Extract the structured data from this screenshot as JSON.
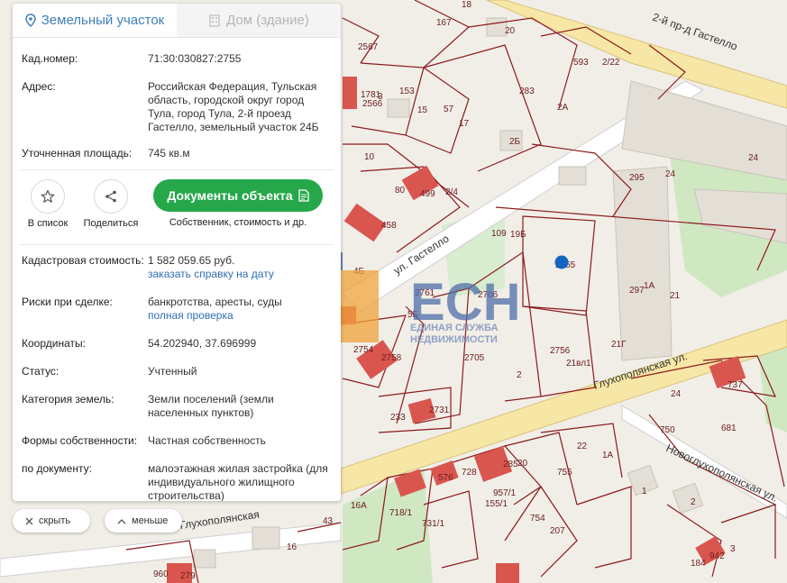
{
  "tabs": [
    {
      "label": "Земельный участок",
      "icon": "map-pin-icon",
      "active": true
    },
    {
      "label": "Дом (здание)",
      "icon": "building-icon",
      "active": false
    }
  ],
  "info": {
    "cadastral_label": "Кад.номер:",
    "cadastral_value": "71:30:030827:2755",
    "address_label": "Адрес:",
    "address_value": "Российская Федерация, Тульская область, городской округ город Тула, город Тула, 2-й проезд Гастелло, земельный участок 24Б",
    "area_label": "Уточненная площадь:",
    "area_value": "745 кв.м"
  },
  "actions": {
    "favorite_label": "В список",
    "share_label": "Поделиться",
    "docs_button": "Документы объекта",
    "docs_sub": "Собственник, стоимость и др."
  },
  "details": {
    "cost_label": "Кадастровая стоимость:",
    "cost_value": "1 582 059.65 руб.",
    "cost_link": "заказать справку на дату",
    "risk_label": "Риски при сделке:",
    "risk_value": "банкротства, аресты, суды",
    "risk_link": "полная проверка",
    "coords_label": "Координаты:",
    "coords_value": "54.202940, 37.696999",
    "status_label": "Статус:",
    "status_value": "Учтенный",
    "category_label": "Категория земель:",
    "category_value": "Земли поселений (земли населенных пунктов)",
    "ownership_label": "Формы собственности:",
    "ownership_value": "Частная собственность",
    "document_label": "по документу:",
    "document_value": "малоэтажная жилая застройка (для индивидуального жилищного строительства)"
  },
  "controls": {
    "hide_label": "скрыть",
    "less_label": "меньше"
  },
  "map": {
    "streets": [
      "2-й пр-д Гастелло",
      "ул. Гастелло",
      "Глухополянская ул.",
      "Новоглухополянская ул.",
      "Глухополянская"
    ],
    "watermark_big": "ЕСН",
    "watermark_line1": "ЕДИНАЯ СЛУЖБА",
    "watermark_line2": "НЕДВИЖИМОСТИ",
    "plot_labels": [
      "167",
      "18",
      "20",
      "593",
      "2/22",
      "153",
      "15",
      "57",
      "283",
      "2А",
      "17",
      "2Б",
      "10",
      "80",
      "2/4",
      "109",
      "19Б",
      "2755",
      "295",
      "24",
      "24",
      "297",
      "1А",
      "21",
      "2761",
      "2706",
      "5Б",
      "4Б",
      "2754",
      "2758",
      "2705",
      "2756",
      "21вл1",
      "21Г",
      "233",
      "2731",
      "2",
      "737",
      "24",
      "750",
      "681",
      "22",
      "1А",
      "576",
      "728",
      "285",
      "20",
      "755",
      "957/1",
      "155/1",
      "16А",
      "718/1",
      "731/1",
      "754",
      "207",
      "43",
      "16",
      "960",
      "279",
      "1",
      "2",
      "184",
      "942",
      "3",
      "1781",
      "2566",
      "2567",
      "3",
      "499",
      "458",
      "4"
    ],
    "marker_color": "#1565c0",
    "boundary_color": "#8b1a1a",
    "building_color": "#d9564f"
  }
}
